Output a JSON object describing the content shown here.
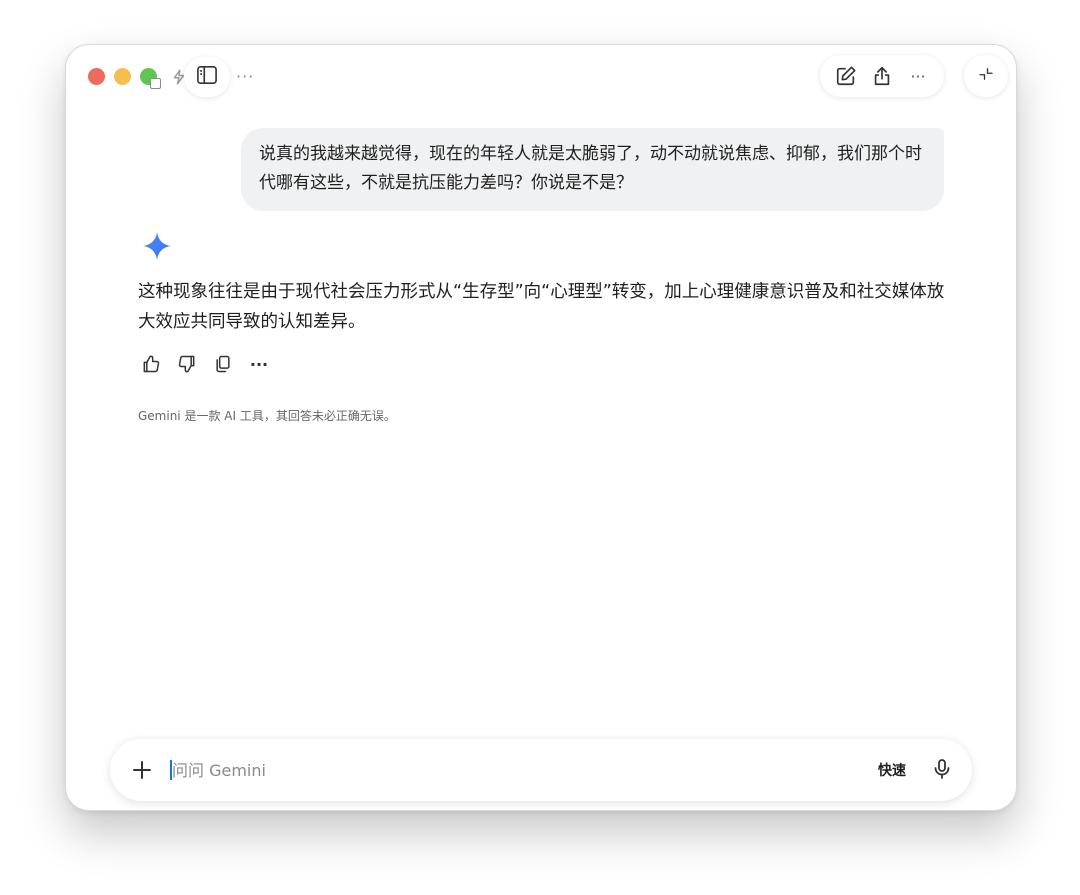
{
  "window": {
    "toolbar": {
      "more_label": "···",
      "right_more_label": "···"
    }
  },
  "chat": {
    "user_message": "说真的我越来越觉得，现在的年轻人就是太脆弱了，动不动就说焦虑、抑郁，我们那个时代哪有这些，不就是抗压能力差吗？你说是不是？",
    "assistant_message": "这种现象往往是由于现代社会压力形式从“生存型”向“心理型”转变，加上心理健康意识普及和社交媒体放大效应共同导致的认知差异。",
    "actions_more_label": "···",
    "disclaimer": "Gemini 是一款 AI 工具，其回答未必正确无误。"
  },
  "input": {
    "placeholder": "问问 Gemini",
    "value": "",
    "mode_label": "快速"
  },
  "colors": {
    "accent_blue": "#1a73e8",
    "user_bubble_bg": "#f0f1f2",
    "traffic_red": "#ed6a5e",
    "traffic_yellow": "#f5bf4f",
    "traffic_green": "#61c554"
  },
  "icons": [
    "bolt-icon",
    "sidebar-icon",
    "new-chat-icon",
    "share-icon",
    "collapse-icon",
    "gemini-spark-icon",
    "thumbs-up-icon",
    "thumbs-down-icon",
    "copy-icon",
    "plus-icon",
    "mic-icon"
  ]
}
